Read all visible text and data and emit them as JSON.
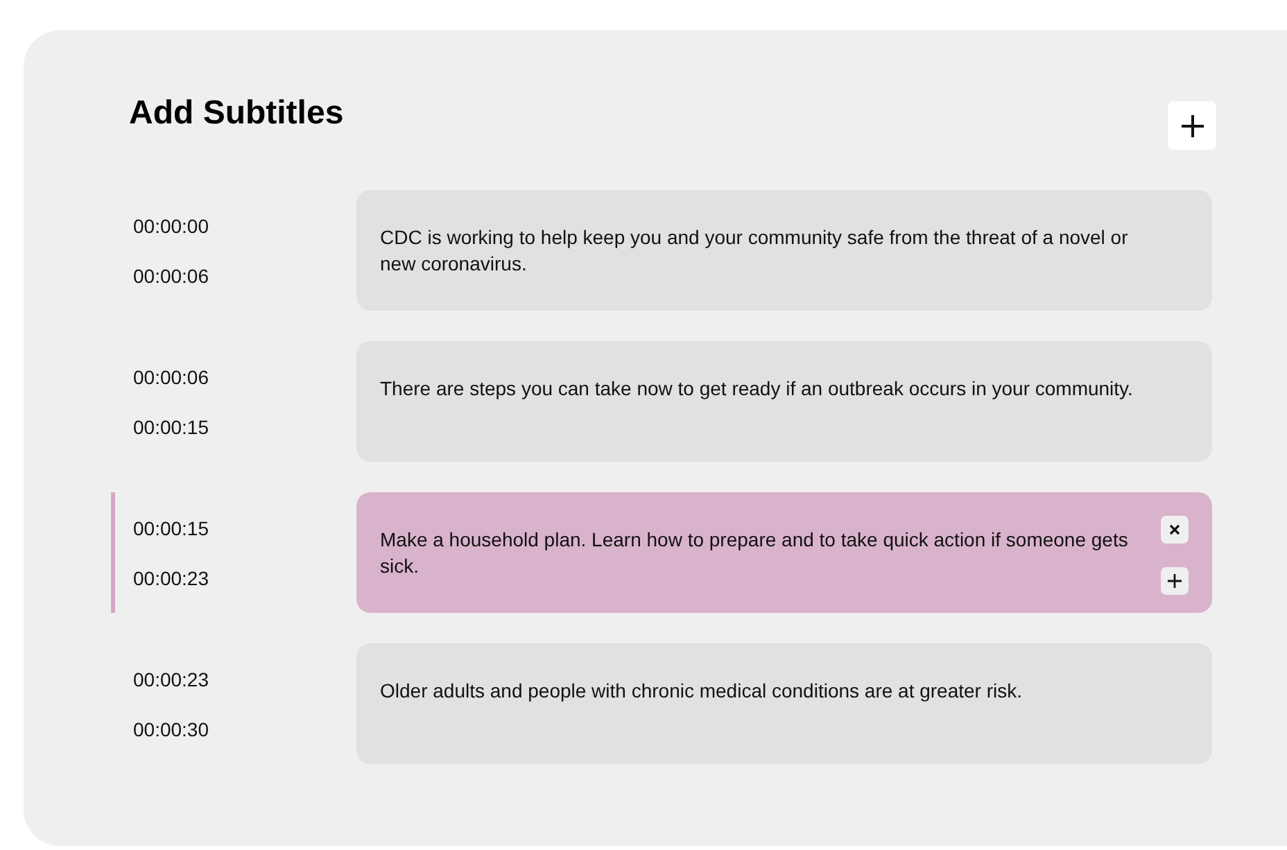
{
  "title": "Add Subtitles",
  "subtitles": [
    {
      "start": "00:00:00",
      "end": "00:00:06",
      "text": "CDC is working to help keep you and your community safe from the threat of a novel or new coronavirus.",
      "selected": false
    },
    {
      "start": "00:00:06",
      "end": "00:00:15",
      "text": "There are steps you can take now to get ready if an outbreak occurs in your community.",
      "selected": false
    },
    {
      "start": "00:00:15",
      "end": "00:00:23",
      "text": "Make a household plan. Learn how to prepare and to take quick action if someone gets sick.",
      "selected": true
    },
    {
      "start": "00:00:23",
      "end": "00:00:30",
      "text": "Older adults and people with chronic medical conditions are at greater risk.",
      "selected": false
    }
  ]
}
